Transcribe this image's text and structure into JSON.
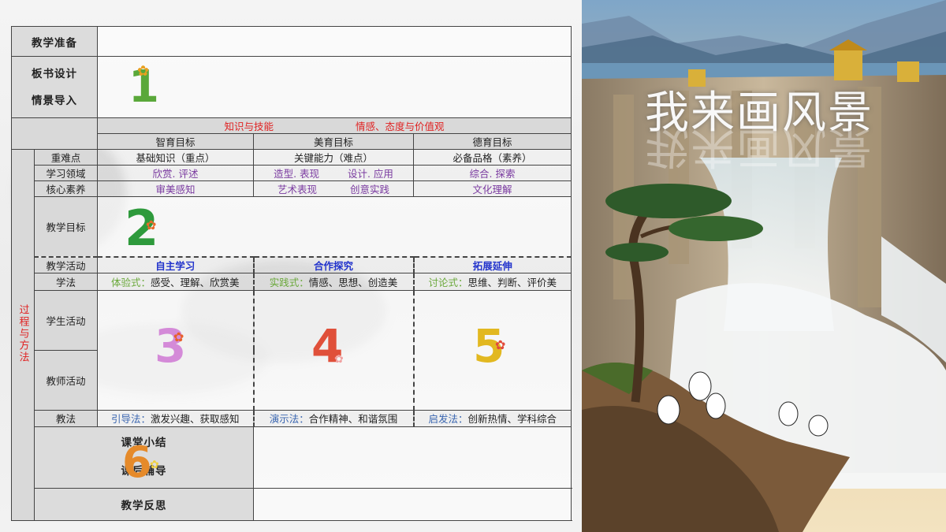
{
  "sections": {
    "prep": "教学准备",
    "board": "板书设计",
    "intro": "情景导入",
    "summary": "课堂小结",
    "homework": "课后辅导",
    "reflection": "教学反思"
  },
  "process_label": "过程与方法",
  "goals_header": {
    "knowledge": "知识与技能",
    "emotion": "情感、态度与价值观"
  },
  "goal_columns": [
    "智育目标",
    "美育目标",
    "德育目标"
  ],
  "rows": {
    "difficulty": {
      "label": "重难点",
      "c1": "基础知识（重点）",
      "c2": "关键能力（难点）",
      "c3": "必备品格（素养）"
    },
    "domain": {
      "label": "学习领域",
      "c1": "欣赏. 评述",
      "c2a": "造型. 表现",
      "c2b": "设计. 应用",
      "c3": "综合. 探索"
    },
    "literacy": {
      "label": "核心素养",
      "c1": "审美感知",
      "c2a": "艺术表现",
      "c2b": "创意实践",
      "c3": "文化理解"
    },
    "objective": {
      "label": "教学目标"
    },
    "activity": {
      "label": "教学活动",
      "c1": "自主学习",
      "c2": "合作探究",
      "c3": "拓展延伸"
    },
    "method": {
      "label": "学法",
      "c1_tag": "体验式：",
      "c1": "感受、理解、欣赏美",
      "c2_tag": "实践式：",
      "c2": "情感、思想、创造美",
      "c3_tag": "讨论式：",
      "c3": "思维、判断、评价美"
    },
    "student": {
      "label": "学生活动"
    },
    "teacher_act": {
      "label": "教师活动"
    },
    "teaching": {
      "label": "教法",
      "c1_tag": "引导法：",
      "c1": "激发兴趣、获取感知",
      "c2_tag": "演示法：",
      "c2": "合作精神、和谐氛围",
      "c3_tag": "启发法：",
      "c3": "创新热情、学科综合"
    }
  },
  "numbers": [
    "1",
    "2",
    "3",
    "4",
    "5",
    "6"
  ],
  "number_colors": [
    "#5aa83a",
    "#2e9a3c",
    "#d48ad8",
    "#e0503a",
    "#e2b820",
    "#e58a2a"
  ],
  "title": "我来画风景",
  "colors": {
    "accent_red": "#e02222",
    "accent_purple": "#7a3aa0",
    "accent_blue": "#2233cc"
  },
  "icons": [
    "flower-icon"
  ]
}
